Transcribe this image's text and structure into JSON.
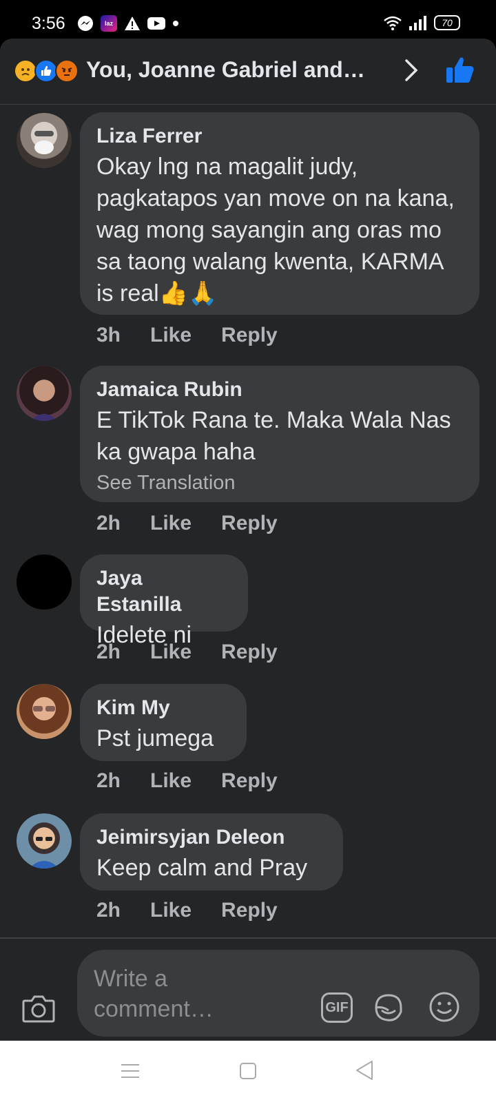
{
  "status": {
    "time": "3:56",
    "battery": "70",
    "app_badge": "laz"
  },
  "header": {
    "title": "You, Joanne Gabriel and…"
  },
  "comments": [
    {
      "author": "Liza Ferrer",
      "text": "Okay lng na magalit judy, pagkatapos yan move on na kana, wag mong sayangin ang oras mo sa taong walang kwenta, KARMA is real👍🙏",
      "time": "3h",
      "like": "Like",
      "reply": "Reply"
    },
    {
      "author": "Jamaica Rubin",
      "text": "E TikTok Rana te. Maka Wala Nas ka gwapa haha",
      "translate": "See Translation",
      "time": "2h",
      "like": "Like",
      "reply": "Reply"
    },
    {
      "author": "Jaya Estanilla",
      "text": "Idelete ni",
      "time": "2h",
      "like": "Like",
      "reply": "Reply"
    },
    {
      "author": "Kim My",
      "text": "Pst jumega",
      "time": "2h",
      "like": "Like",
      "reply": "Reply"
    },
    {
      "author": "Jeimirsyjan Deleon",
      "text": "Keep calm and Pray",
      "time": "2h",
      "like": "Like",
      "reply": "Reply"
    }
  ],
  "composer": {
    "placeholder": "Write a comment…",
    "gif_label": "GIF"
  },
  "colors": {
    "sheet_bg": "#242526",
    "bubble_bg": "#3a3b3c",
    "text_primary": "#e4e6eb",
    "text_secondary": "#b0b3b8",
    "like_blue": "#1877f2"
  }
}
